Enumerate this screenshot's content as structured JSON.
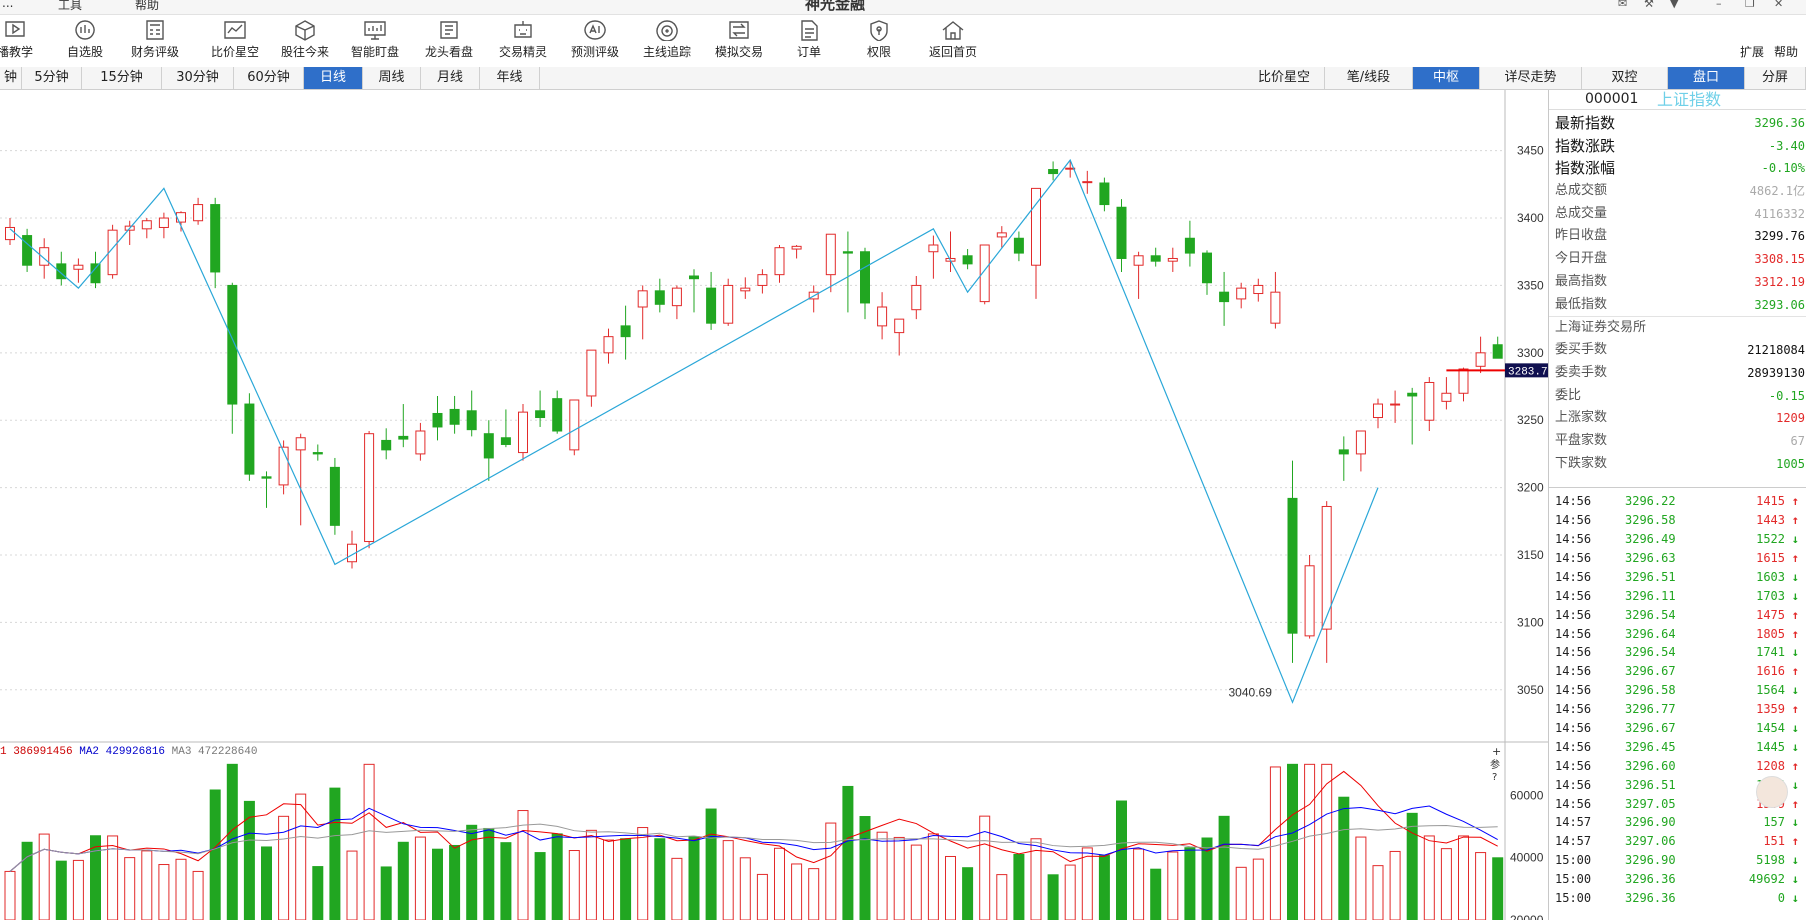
{
  "topbar": {
    "menu_left": "...",
    "menu_tools": "工具",
    "menu_help": "帮助",
    "title": "神光金融"
  },
  "toolbar": {
    "items": [
      {
        "label": "播教学",
        "icon": "play-icon"
      },
      {
        "label": "自选股",
        "icon": "watchlist-icon"
      },
      {
        "label": "财务评级",
        "icon": "calculator-icon"
      },
      {
        "label": "比价星空",
        "icon": "chart-compare-icon"
      },
      {
        "label": "股往今来",
        "icon": "cube-icon"
      },
      {
        "label": "智能盯盘",
        "icon": "monitor-icon"
      },
      {
        "label": "龙头看盘",
        "icon": "dragon-icon"
      },
      {
        "label": "交易精灵",
        "icon": "robot-icon"
      },
      {
        "label": "预测评级",
        "icon": "ai-icon"
      },
      {
        "label": "主线追踪",
        "icon": "target-icon"
      },
      {
        "label": "模拟交易",
        "icon": "exchange-icon"
      },
      {
        "label": "订单",
        "icon": "document-icon"
      },
      {
        "label": "权限",
        "icon": "shield-icon"
      },
      {
        "label": "返回首页",
        "icon": "home-icon"
      }
    ],
    "expand": "扩展",
    "help": "帮助"
  },
  "periods": [
    "钟",
    "5分钟",
    "15分钟",
    "30分钟",
    "60分钟",
    "日线",
    "周线",
    "月线",
    "年线"
  ],
  "active_period": "日线",
  "views": [
    "比价星空",
    "笔/线段",
    "中枢",
    "详尽走势",
    "双控",
    "盘口",
    "分屏"
  ],
  "active_views": [
    "中枢",
    "盘口"
  ],
  "colors": {
    "up": "#e22a2a",
    "down": "#21a621",
    "pen": "#2aa7d8",
    "accent": "#2f6fc9",
    "price_tag": "#101050"
  },
  "chart_data": {
    "type": "candlestick",
    "y_ticks": [
      3050,
      3100,
      3150,
      3200,
      3250,
      3300,
      3350,
      3400,
      3450
    ],
    "ylim": [
      3035,
      3495
    ],
    "candles": [
      [
        3384,
        3400,
        3380,
        3393
      ],
      [
        3387,
        3392,
        3360,
        3365
      ],
      [
        3365,
        3385,
        3355,
        3378
      ],
      [
        3366,
        3375,
        3350,
        3355
      ],
      [
        3362,
        3370,
        3352,
        3365
      ],
      [
        3366,
        3375,
        3348,
        3352
      ],
      [
        3358,
        3395,
        3355,
        3391
      ],
      [
        3391,
        3398,
        3380,
        3394
      ],
      [
        3392,
        3400,
        3385,
        3398
      ],
      [
        3393,
        3404,
        3385,
        3400
      ],
      [
        3397,
        3405,
        3390,
        3404
      ],
      [
        3398,
        3415,
        3395,
        3410
      ],
      [
        3410,
        3415,
        3348,
        3360
      ],
      [
        3350,
        3352,
        3240,
        3262
      ],
      [
        3262,
        3270,
        3205,
        3210
      ],
      [
        3208,
        3212,
        3185,
        3207
      ],
      [
        3202,
        3235,
        3195,
        3230
      ],
      [
        3228,
        3240,
        3172,
        3237
      ],
      [
        3226,
        3232,
        3220,
        3225
      ],
      [
        3215,
        3222,
        3165,
        3172
      ],
      [
        3145,
        3168,
        3140,
        3158
      ],
      [
        3160,
        3242,
        3155,
        3240
      ],
      [
        3235,
        3244,
        3221,
        3228
      ],
      [
        3238,
        3262,
        3230,
        3236
      ],
      [
        3225,
        3248,
        3220,
        3242
      ],
      [
        3255,
        3268,
        3235,
        3245
      ],
      [
        3258,
        3268,
        3240,
        3247
      ],
      [
        3257,
        3272,
        3238,
        3243
      ],
      [
        3240,
        3250,
        3205,
        3222
      ],
      [
        3237,
        3258,
        3230,
        3232
      ],
      [
        3226,
        3262,
        3220,
        3256
      ],
      [
        3257,
        3272,
        3245,
        3252
      ],
      [
        3266,
        3272,
        3240,
        3242
      ],
      [
        3228,
        3258,
        3224,
        3265
      ],
      [
        3268,
        3300,
        3260,
        3302
      ],
      [
        3300,
        3318,
        3292,
        3312
      ],
      [
        3320,
        3335,
        3295,
        3312
      ],
      [
        3334,
        3350,
        3310,
        3346
      ],
      [
        3346,
        3355,
        3330,
        3336
      ],
      [
        3335,
        3350,
        3325,
        3348
      ],
      [
        3357,
        3362,
        3330,
        3355
      ],
      [
        3348,
        3360,
        3317,
        3322
      ],
      [
        3322,
        3355,
        3320,
        3350
      ],
      [
        3346,
        3356,
        3340,
        3348
      ],
      [
        3350,
        3362,
        3344,
        3358
      ],
      [
        3358,
        3380,
        3352,
        3378
      ],
      [
        3377,
        3380,
        3370,
        3379
      ],
      [
        3340,
        3350,
        3330,
        3345
      ],
      [
        3358,
        3388,
        3345,
        3388
      ],
      [
        3375,
        3390,
        3330,
        3374
      ],
      [
        3375,
        3378,
        3325,
        3337
      ],
      [
        3320,
        3345,
        3310,
        3334
      ],
      [
        3315,
        3322,
        3298,
        3325
      ],
      [
        3332,
        3357,
        3325,
        3350
      ],
      [
        3375,
        3387,
        3355,
        3380
      ],
      [
        3368,
        3390,
        3360,
        3370
      ],
      [
        3372,
        3377,
        3362,
        3366
      ],
      [
        3338,
        3378,
        3336,
        3380
      ],
      [
        3386,
        3394,
        3378,
        3389
      ],
      [
        3385,
        3390,
        3368,
        3374
      ],
      [
        3365,
        3365,
        3340,
        3422
      ],
      [
        3436,
        3442,
        3428,
        3433
      ],
      [
        3437,
        3443,
        3430,
        3437
      ],
      [
        3427,
        3435,
        3418,
        3427
      ],
      [
        3426,
        3430,
        3405,
        3410
      ],
      [
        3408,
        3414,
        3360,
        3370
      ],
      [
        3365,
        3375,
        3340,
        3372
      ],
      [
        3372,
        3378,
        3364,
        3368
      ],
      [
        3368,
        3378,
        3360,
        3370
      ],
      [
        3385,
        3398,
        3364,
        3374
      ],
      [
        3374,
        3376,
        3343,
        3352
      ],
      [
        3345,
        3360,
        3320,
        3338
      ],
      [
        3340,
        3352,
        3333,
        3348
      ],
      [
        3344,
        3355,
        3338,
        3350
      ],
      [
        3322,
        3360,
        3318,
        3345
      ],
      [
        3192,
        3220,
        3070,
        3092
      ],
      [
        3090,
        3150,
        3088,
        3142
      ],
      [
        3095,
        3190,
        3070,
        3186
      ],
      [
        3228,
        3238,
        3205,
        3225
      ],
      [
        3225,
        3240,
        3212,
        3242
      ],
      [
        3252,
        3266,
        3244,
        3262
      ],
      [
        3262,
        3272,
        3248,
        3262
      ],
      [
        3270,
        3274,
        3232,
        3268
      ],
      [
        3250,
        3282,
        3242,
        3278
      ],
      [
        3264,
        3282,
        3258,
        3270
      ],
      [
        3270,
        3289,
        3264,
        3288
      ],
      [
        3290,
        3312,
        3285,
        3300
      ],
      [
        3306,
        3312,
        3296,
        3296
      ]
    ],
    "pens": [
      [
        0,
        3392
      ],
      [
        4,
        3348
      ],
      [
        9,
        3422
      ],
      [
        19,
        3143
      ],
      [
        54,
        3392
      ],
      [
        56,
        3345
      ],
      [
        62,
        3443
      ],
      [
        75,
        3040.69
      ],
      [
        80,
        3200
      ]
    ],
    "low_label": "3040.69",
    "last_price_tag": "3283.7",
    "volume": {
      "ma_labels": {
        "ma1": "1",
        "ma1_value": "386991456",
        "ma2": "MA2",
        "ma2_value": "429926816",
        "ma3": "MA3",
        "ma3_value": "472228640"
      },
      "y_ticks": [
        20000,
        40000,
        60000
      ],
      "ylim": [
        20000,
        73000
      ]
    },
    "side_markers": {
      "plus": "+",
      "ref": "参",
      "q": "?"
    }
  },
  "quote": {
    "code": "000001",
    "name": "上证指数",
    "rows": [
      {
        "label": "最新指数",
        "value": "3296.36",
        "color": "down",
        "big": true
      },
      {
        "label": "指数涨跌",
        "value": "-3.40",
        "color": "down",
        "big": true
      },
      {
        "label": "指数涨幅",
        "value": "-0.10%",
        "color": "down",
        "big": true
      },
      {
        "label": "总成交额",
        "value": "4862.1亿",
        "color": "grey",
        "big": false
      },
      {
        "label": "总成交量",
        "value": "4116332",
        "color": "grey",
        "big": false
      },
      {
        "label": "昨日收盘",
        "value": "3299.76",
        "color": "black",
        "big": false
      },
      {
        "label": "今日开盘",
        "value": "3308.15",
        "color": "up",
        "big": false
      },
      {
        "label": "最高指数",
        "value": "3312.19",
        "color": "up",
        "big": false
      },
      {
        "label": "最低指数",
        "value": "3293.06",
        "color": "down",
        "big": false
      }
    ],
    "exchange": "上海证券交易所",
    "rows2": [
      {
        "label": "委买手数",
        "value": "21218084",
        "color": "black"
      },
      {
        "label": "委卖手数",
        "value": "28939130",
        "color": "black"
      },
      {
        "label": "委比",
        "value": "-0.15",
        "color": "down"
      },
      {
        "label": "上涨家数",
        "value": "1209",
        "color": "up"
      },
      {
        "label": "平盘家数",
        "value": "67",
        "color": "grey"
      },
      {
        "label": "下跌家数",
        "value": "1005",
        "color": "down"
      }
    ]
  },
  "trades": [
    {
      "time": "14:56",
      "price": "3296.22",
      "vol": "1415",
      "dir": "up"
    },
    {
      "time": "14:56",
      "price": "3296.58",
      "vol": "1443",
      "dir": "up"
    },
    {
      "time": "14:56",
      "price": "3296.49",
      "vol": "1522",
      "dir": "down"
    },
    {
      "time": "14:56",
      "price": "3296.63",
      "vol": "1615",
      "dir": "up"
    },
    {
      "time": "14:56",
      "price": "3296.51",
      "vol": "1603",
      "dir": "down"
    },
    {
      "time": "14:56",
      "price": "3296.11",
      "vol": "1703",
      "dir": "down"
    },
    {
      "time": "14:56",
      "price": "3296.54",
      "vol": "1475",
      "dir": "up"
    },
    {
      "time": "14:56",
      "price": "3296.64",
      "vol": "1805",
      "dir": "up"
    },
    {
      "time": "14:56",
      "price": "3296.54",
      "vol": "1741",
      "dir": "down"
    },
    {
      "time": "14:56",
      "price": "3296.67",
      "vol": "1616",
      "dir": "up"
    },
    {
      "time": "14:56",
      "price": "3296.58",
      "vol": "1564",
      "dir": "down"
    },
    {
      "time": "14:56",
      "price": "3296.77",
      "vol": "1359",
      "dir": "up"
    },
    {
      "time": "14:56",
      "price": "3296.67",
      "vol": "1454",
      "dir": "down"
    },
    {
      "time": "14:56",
      "price": "3296.45",
      "vol": "1445",
      "dir": "down"
    },
    {
      "time": "14:56",
      "price": "3296.60",
      "vol": "1208",
      "dir": "up"
    },
    {
      "time": "14:56",
      "price": "3296.51",
      "vol": "1204",
      "dir": "down"
    },
    {
      "time": "14:56",
      "price": "3297.05",
      "vol": "1359",
      "dir": "up"
    },
    {
      "time": "14:57",
      "price": "3296.90",
      "vol": "157",
      "dir": "down"
    },
    {
      "time": "14:57",
      "price": "3297.06",
      "vol": "151",
      "dir": "up"
    },
    {
      "time": "15:00",
      "price": "3296.90",
      "vol": "5198",
      "dir": "down"
    },
    {
      "time": "15:00",
      "price": "3296.36",
      "vol": "49692",
      "dir": "down"
    },
    {
      "time": "15:00",
      "price": "3296.36",
      "vol": "0",
      "dir": "down"
    }
  ]
}
